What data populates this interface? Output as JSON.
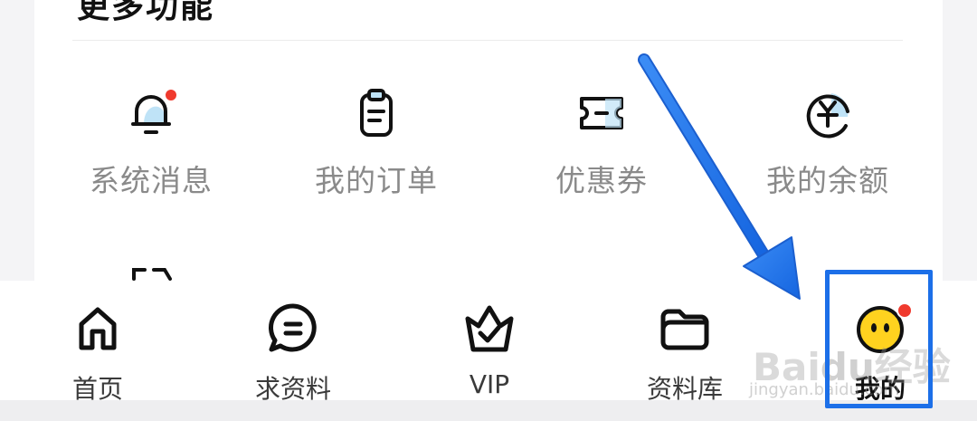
{
  "section": {
    "title": "更多功能"
  },
  "functions": [
    {
      "label": "系统消息",
      "icon": "bell-icon"
    },
    {
      "label": "我的订单",
      "icon": "clipboard-icon"
    },
    {
      "label": "优惠券",
      "icon": "ticket-icon"
    },
    {
      "label": "我的余额",
      "icon": "yen-coin-icon"
    }
  ],
  "tabbar": {
    "items": [
      {
        "label": "首页",
        "icon": "home-icon"
      },
      {
        "label": "求资料",
        "icon": "chat-bubble-icon"
      },
      {
        "label": "VIP",
        "icon": "crown-icon"
      },
      {
        "label": "资料库",
        "icon": "folder-icon"
      },
      {
        "label": "我的",
        "icon": "smiley-face-icon",
        "active": true
      }
    ]
  },
  "watermark": {
    "logo": "Baidu经验",
    "url": "jingyan.baidu.com"
  },
  "colors": {
    "badge": "#f03a2e",
    "highlight": "#1c6fe8",
    "avatar": "#ffd21f",
    "icon_accent": "#bfe3f7"
  }
}
